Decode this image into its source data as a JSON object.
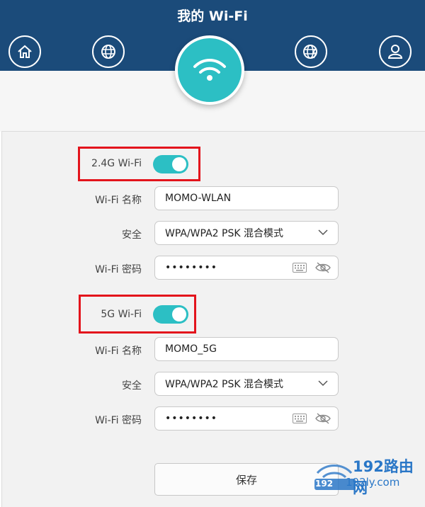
{
  "header": {
    "title": "我的 Wi-Fi"
  },
  "nav": {
    "items": [
      {
        "icon": "home-icon"
      },
      {
        "icon": "globe-icon"
      },
      {
        "icon": "wifi-icon"
      },
      {
        "icon": "globe-lightning-icon"
      },
      {
        "icon": "user-icon"
      }
    ]
  },
  "wifi_24": {
    "label": "2.4G Wi-Fi",
    "enabled": true,
    "name_label": "Wi-Fi 名称",
    "name_value": "MOMO-WLAN",
    "security_label": "安全",
    "security_value": "WPA/WPA2 PSK 混合模式",
    "password_label": "Wi-Fi 密码",
    "password_value": "••••••••"
  },
  "wifi_5": {
    "label": "5G Wi-Fi",
    "enabled": true,
    "name_label": "Wi-Fi 名称",
    "name_value": "MOMO_5G",
    "security_label": "安全",
    "security_value": "WPA/WPA2 PSK 混合模式",
    "password_label": "Wi-Fi 密码",
    "password_value": "••••••••"
  },
  "actions": {
    "save_label": "保存"
  },
  "watermark": {
    "brand": "192路由网",
    "url": "192ly.com",
    "badge": "192"
  },
  "colors": {
    "header": "#1b4b7a",
    "accent": "#2cbfc4",
    "highlight": "#e3141c"
  }
}
